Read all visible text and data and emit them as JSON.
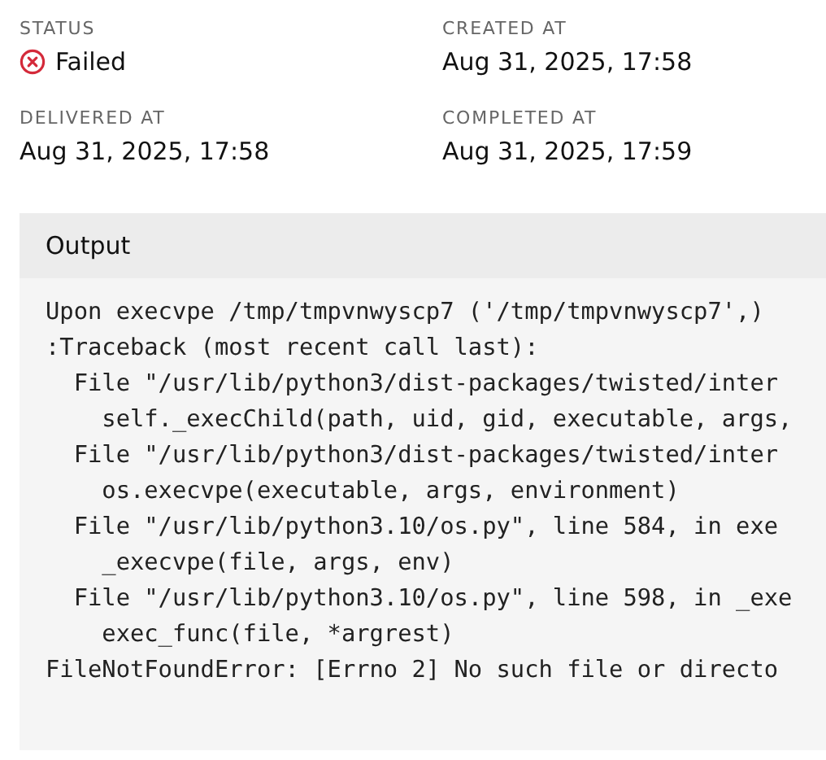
{
  "details": [
    {
      "label": "STATUS",
      "value": "Failed",
      "kind": "status",
      "failed": true
    },
    {
      "label": "CREATED AT",
      "value": "Aug 31, 2025, 17:58",
      "kind": "text"
    },
    {
      "label": "DELIVERED AT",
      "value": "Aug 31, 2025, 17:58",
      "kind": "text"
    },
    {
      "label": "COMPLETED AT",
      "value": "Aug 31, 2025, 17:59",
      "kind": "text"
    }
  ],
  "output": {
    "title": "Output",
    "lines": [
      "Upon execvpe /tmp/tmpvnwyscp7 ('/tmp/tmpvnwyscp7',)",
      ":Traceback (most recent call last):",
      "  File \"/usr/lib/python3/dist-packages/twisted/inter",
      "    self._execChild(path, uid, gid, executable, args,",
      "  File \"/usr/lib/python3/dist-packages/twisted/inter",
      "    os.execvpe(executable, args, environment)",
      "  File \"/usr/lib/python3.10/os.py\", line 584, in exe",
      "    _execvpe(file, args, env)",
      "  File \"/usr/lib/python3.10/os.py\", line 598, in _exe",
      "    exec_func(file, *argrest)",
      "FileNotFoundError: [Errno 2] No such file or directo"
    ]
  }
}
